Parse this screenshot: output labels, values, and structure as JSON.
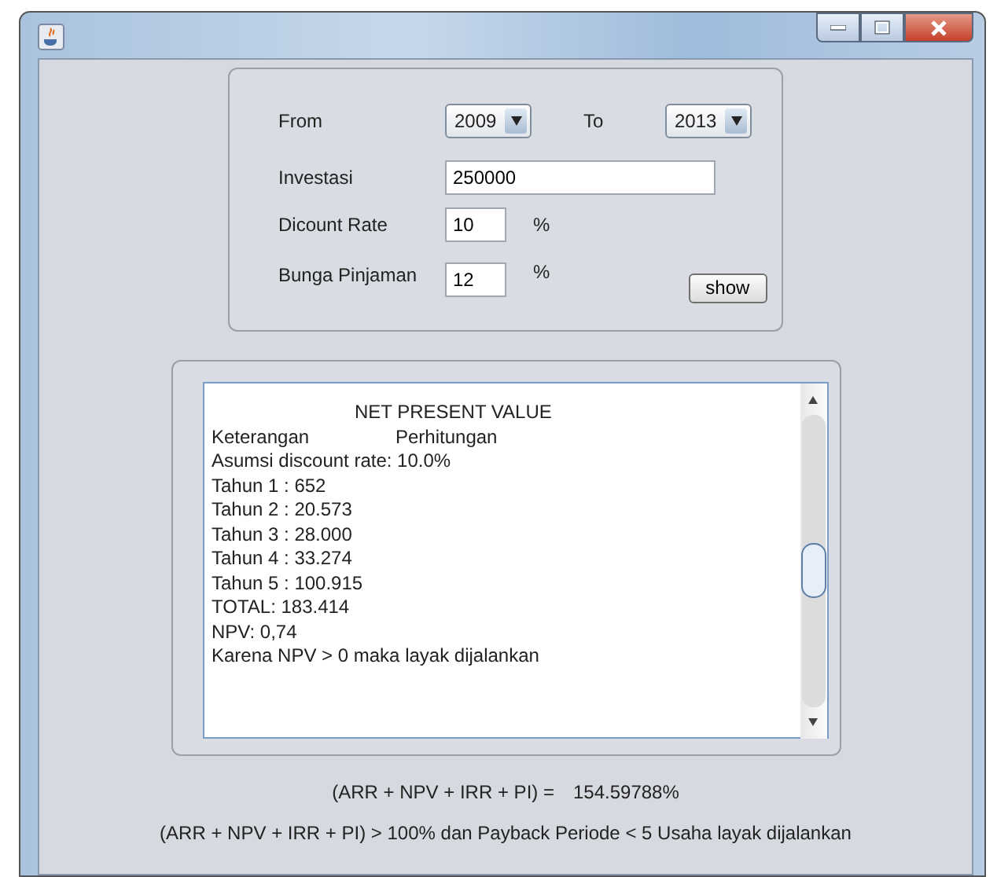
{
  "window": {
    "title_buttons": [
      {
        "kind": "minimize"
      },
      {
        "kind": "maximize"
      },
      {
        "kind": "close"
      }
    ]
  },
  "form": {
    "from_label": "From",
    "from_value": "2009",
    "to_label": "To",
    "to_value": "2013",
    "investasi_label": "Investasi",
    "investasi_value": "250000",
    "discount_label": "Dicount Rate",
    "discount_value": "10",
    "discount_unit": "%",
    "bunga_label": "Bunga Pinjaman",
    "bunga_value": "12",
    "bunga_unit": "%",
    "show_button": "show"
  },
  "report": {
    "lines": [
      {
        "kind": "heading",
        "text": "NET PRESENT VALUE"
      },
      {
        "kind": "columns",
        "cells": [
          "Keterangan",
          "Perhitungan"
        ]
      },
      {
        "kind": "text",
        "text": "Asumsi discount rate: 10.0%"
      },
      {
        "kind": "text",
        "text": "Tahun 1 : 652"
      },
      {
        "kind": "text",
        "text": "Tahun 2 : 20.573"
      },
      {
        "kind": "text",
        "text": "Tahun 3 : 28.000"
      },
      {
        "kind": "text",
        "text": "Tahun 4 : 33.274"
      },
      {
        "kind": "text",
        "text": "Tahun 5 : 100.915"
      },
      {
        "kind": "text",
        "text": "TOTAL: 183.414"
      },
      {
        "kind": "text",
        "text": "NPV: 0,74"
      },
      {
        "kind": "text",
        "text": "Karena NPV > 0 maka layak dijalankan"
      }
    ]
  },
  "summary": {
    "formula": "(ARR + NPV + IRR + PI) =",
    "result": "154.59788%",
    "conclusion": "(ARR + NPV + IRR + PI) > 100% dan Payback Periode < 5 Usaha layak dijalankan"
  }
}
